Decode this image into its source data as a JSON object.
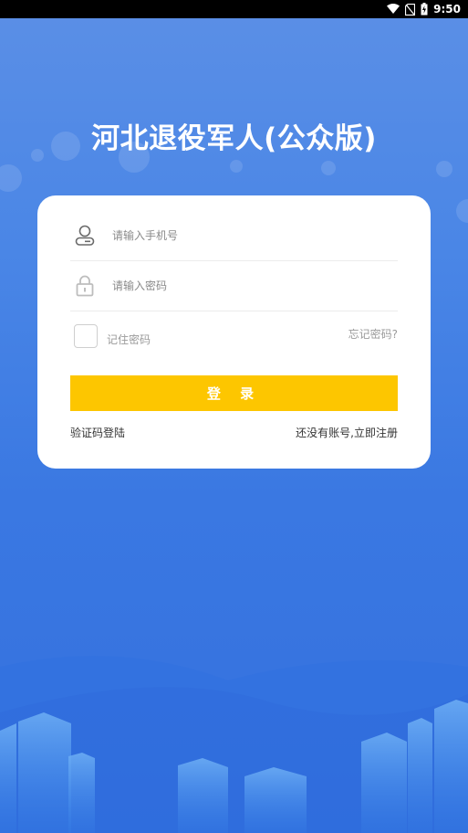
{
  "status_bar": {
    "time": "9:50",
    "icons": [
      "wifi-icon",
      "no-sim-icon",
      "battery-charging-icon"
    ]
  },
  "app": {
    "title": "河北退役军人(公众版)"
  },
  "login_form": {
    "phone_placeholder": "请输入手机号",
    "password_placeholder": "请输入密码",
    "remember_label": "记住密码",
    "forgot_label": "忘记密码?",
    "login_label": "登 录",
    "sms_login_label": "验证码登陆",
    "register_label": "还没有账号,立即注册",
    "user_icon": "user-icon",
    "lock_icon": "lock-icon"
  },
  "colors": {
    "accent": "#fdc600",
    "background_top": "#5b8fe6",
    "background_bottom": "#3470de",
    "card": "#ffffff"
  }
}
